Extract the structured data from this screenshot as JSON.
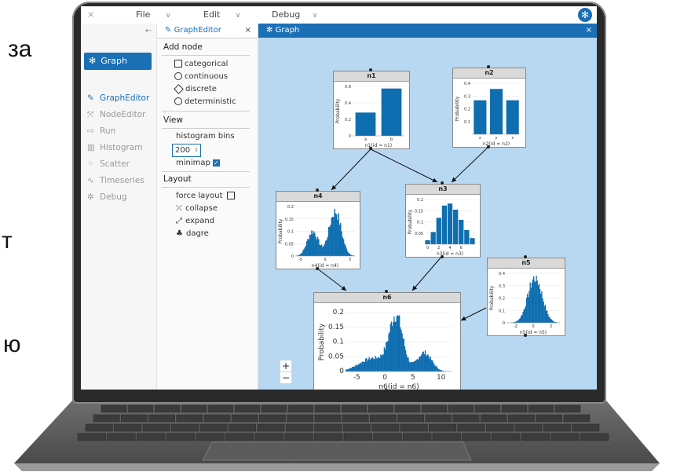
{
  "side_text": [
    "за",
    "т",
    "ю"
  ],
  "menu": {
    "file": "File",
    "edit": "Edit",
    "debug": "Debug",
    "close_glyph": "×",
    "chevron": "∨"
  },
  "nav": {
    "graph_button": "Graph",
    "items": [
      {
        "label": "GraphEditor",
        "icon": "edit-icon",
        "active": true
      },
      {
        "label": "NodeEditor",
        "icon": "node-icon",
        "active": false
      },
      {
        "label": "Run",
        "icon": "run-icon",
        "active": false
      },
      {
        "label": "Histogram",
        "icon": "histogram-icon",
        "active": false
      },
      {
        "label": "Scatter",
        "icon": "scatter-icon",
        "active": false
      },
      {
        "label": "Timeseries",
        "icon": "timeseries-icon",
        "active": false
      },
      {
        "label": "Debug",
        "icon": "bug-icon",
        "active": false
      }
    ]
  },
  "editor": {
    "tab_label": "GraphEditor",
    "add_node_title": "Add node",
    "node_types": [
      "categorical",
      "continuous",
      "discrete",
      "deterministic"
    ],
    "view_title": "View",
    "histogram_bins_label": "histogram bins",
    "histogram_bins_value": "200",
    "minimap_label": "minimap",
    "layout_title": "Layout",
    "force_layout_label": "force layout",
    "collapse_label": "collapse",
    "expand_label": "expand",
    "dagre_label": "dagre"
  },
  "graph_tab": {
    "label": "Graph"
  },
  "zoom": {
    "in": "+",
    "out": "−"
  },
  "nodes": {
    "n1": {
      "title": "n1",
      "xlabel": "n1(id = n1)",
      "ylabel": "Probability",
      "categories": [
        "a",
        "b"
      ],
      "values": [
        0.33,
        0.67
      ],
      "yticks": [
        "0",
        "0.2",
        "0.4",
        "0.6"
      ]
    },
    "n2": {
      "title": "n2",
      "xlabel": "n2(id = n2)",
      "ylabel": "Probability",
      "categories": [
        "x",
        "y",
        "z"
      ],
      "values": [
        0.3,
        0.4,
        0.3
      ],
      "yticks": [
        "0.1",
        "0.2",
        "0.3",
        "0.4"
      ]
    },
    "n3": {
      "title": "n3",
      "xlabel": "n3(id = n3)",
      "ylabel": "Probability",
      "xticks": [
        "0",
        "2",
        "4",
        "6"
      ],
      "yticks": [
        "0.05",
        "0.1",
        "0.15",
        "0.2"
      ],
      "values": [
        0.02,
        0.06,
        0.13,
        0.19,
        0.2,
        0.17,
        0.12,
        0.07,
        0.03
      ]
    },
    "n4": {
      "title": "n4",
      "xlabel": "n4(id = n4)",
      "ylabel": "Probability",
      "xticks": [
        "-5",
        "0",
        "5"
      ],
      "yticks": [
        "0",
        "0.05",
        "0.1",
        "0.15",
        "0.2"
      ]
    },
    "n5": {
      "title": "n5",
      "xlabel": "n5(id = n5)",
      "ylabel": "Probability",
      "xticks": [
        "-2",
        "0",
        "2"
      ],
      "yticks": [
        "0",
        "0.1",
        "0.2",
        "0.3",
        "0.4"
      ]
    },
    "n6": {
      "title": "n6",
      "xlabel": "n6(id = n6)",
      "ylabel": "Probability",
      "xticks": [
        "-5",
        "0",
        "5",
        "10"
      ],
      "yticks": [
        "0",
        "0.05",
        "0.1",
        "0.15",
        "0.2"
      ]
    }
  },
  "colors": {
    "accent": "#1a6fb5",
    "graph_bg": "#b8d8f2",
    "bar": "#0f6eb0"
  }
}
